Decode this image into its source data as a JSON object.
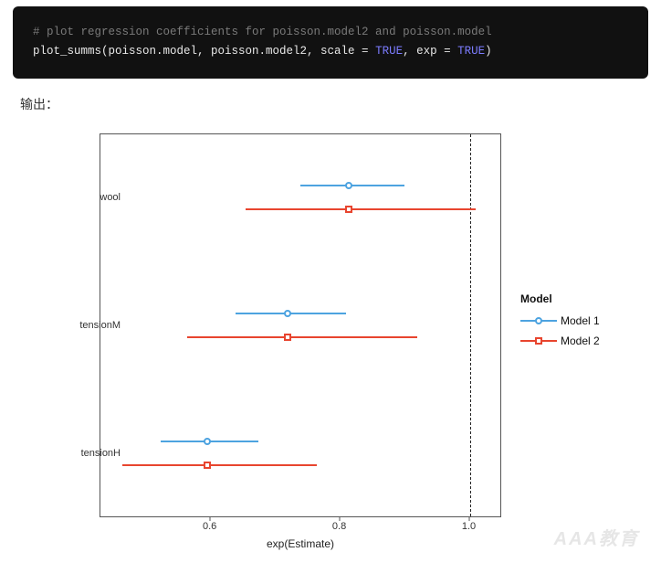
{
  "code": {
    "comment": "# plot regression coefficients for poisson.model2 and poisson.model",
    "fn": "plot_summs",
    "open": "(poisson.model, poisson.model2, scale = ",
    "kw1": "TRUE",
    "mid": ", exp = ",
    "kw2": "TRUE",
    "close": ")"
  },
  "output_label": "输出：",
  "chart_data": {
    "type": "scatter",
    "title": "",
    "xlabel": "exp(Estimate)",
    "ylabel": "",
    "xlim": [
      0.43,
      1.05
    ],
    "reference_line": 1.0,
    "xticks": [
      0.6,
      0.8,
      1.0
    ],
    "categories": [
      "wool",
      "tensionM",
      "tensionH"
    ],
    "series": [
      {
        "name": "Model 1",
        "color": "#4da3e0",
        "shape": "circle",
        "points": [
          {
            "category": "wool",
            "estimate": 0.815,
            "low": 0.74,
            "high": 0.9
          },
          {
            "category": "tensionM",
            "estimate": 0.72,
            "low": 0.64,
            "high": 0.81
          },
          {
            "category": "tensionH",
            "estimate": 0.596,
            "low": 0.525,
            "high": 0.675
          }
        ]
      },
      {
        "name": "Model 2",
        "color": "#e8452f",
        "shape": "square",
        "points": [
          {
            "category": "wool",
            "estimate": 0.815,
            "low": 0.655,
            "high": 1.01
          },
          {
            "category": "tensionM",
            "estimate": 0.72,
            "low": 0.565,
            "high": 0.92
          },
          {
            "category": "tensionH",
            "estimate": 0.596,
            "low": 0.465,
            "high": 0.765
          }
        ]
      }
    ],
    "legend_title": "Model",
    "legend_position": "right"
  },
  "watermark": "AAA教育"
}
